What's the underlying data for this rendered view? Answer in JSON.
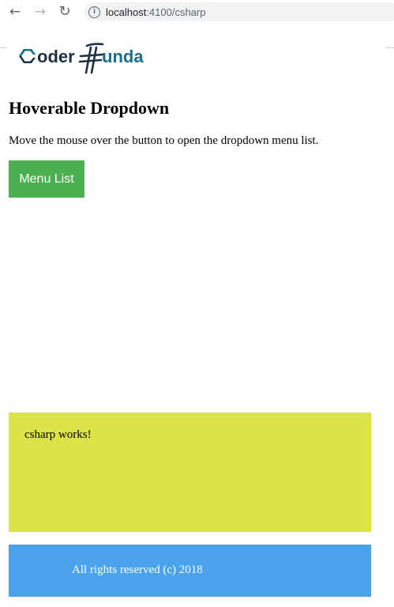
{
  "browser": {
    "url_host": "localhost",
    "url_path": ":4100/csharp",
    "icons": [
      "back-arrow-icon",
      "forward-arrow-icon",
      "reload-icon",
      "info-icon"
    ]
  },
  "logo": {
    "text": "Coder Funda",
    "colors": {
      "dark": "#1f3140",
      "teal": "#1a6f8a"
    }
  },
  "content": {
    "title": "Hoverable Dropdown",
    "description": "Move the mouse over the button to open the dropdown menu list.",
    "menu_button_label": "Menu List",
    "works_text": "csharp works!"
  },
  "footer": {
    "text": "All rights reserved (c) 2018"
  },
  "colors": {
    "button": "#4caf50",
    "works_panel": "#dbe349",
    "footer": "#4aa3ec"
  }
}
